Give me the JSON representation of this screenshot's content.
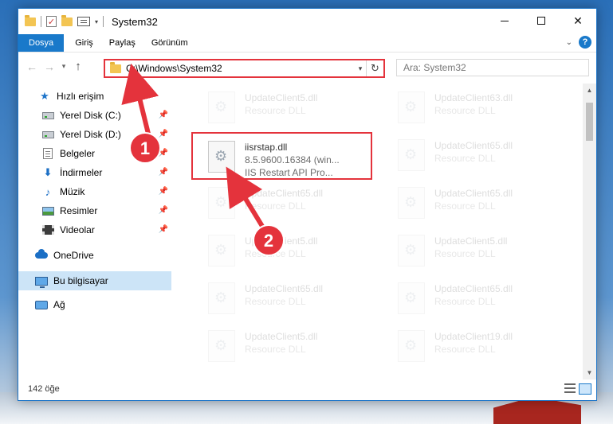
{
  "window": {
    "title": "System32",
    "controls": {
      "minimize": "–",
      "maximize": "□",
      "close": "✕"
    }
  },
  "ribbon": {
    "tabs": [
      "Dosya",
      "Giriş",
      "Paylaş",
      "Görünüm"
    ]
  },
  "address": {
    "path": "C:\\Windows\\System32",
    "search_placeholder": "Ara: System32"
  },
  "sidebar": {
    "items": [
      {
        "label": "Hızlı erişim",
        "icon": "star-icon"
      },
      {
        "label": "Yerel Disk (C:)",
        "icon": "drive-icon",
        "pinned": true
      },
      {
        "label": "Yerel Disk (D:)",
        "icon": "drive-icon",
        "pinned": true
      },
      {
        "label": "Belgeler",
        "icon": "documents-icon",
        "pinned": true
      },
      {
        "label": "İndirmeler",
        "icon": "download-icon",
        "pinned": true
      },
      {
        "label": "Müzik",
        "icon": "music-icon",
        "pinned": true
      },
      {
        "label": "Resimler",
        "icon": "pictures-icon",
        "pinned": true
      },
      {
        "label": "Videolar",
        "icon": "videos-icon",
        "pinned": true
      },
      {
        "label": "OneDrive",
        "icon": "cloud-icon"
      },
      {
        "label": "Bu bilgisayar",
        "icon": "computer-icon",
        "selected": true
      },
      {
        "label": "Ağ",
        "icon": "network-icon"
      }
    ]
  },
  "files": {
    "highlighted": {
      "name": "iisrstap.dll",
      "version": "8.5.9600.16384 (win...",
      "description": "IIS Restart API Pro..."
    },
    "faded": [
      {
        "name": "UpdateClient5.dll",
        "type": "Resource DLL"
      },
      {
        "name": "UpdateClient63.dll",
        "type": "Resource DLL"
      },
      {
        "name": "UpdateClient65.dll",
        "type": "Resource DLL"
      },
      {
        "name": "UpdateClient65.dll",
        "type": "Resource DLL"
      },
      {
        "name": "UpdateClient65.dll",
        "type": "Resource DLL"
      },
      {
        "name": "UpdateClient5.dll",
        "type": "Resource DLL"
      },
      {
        "name": "UpdateClient5.dll",
        "type": "Resource DLL"
      },
      {
        "name": "UpdateClient65.dll",
        "type": "Resource DLL"
      },
      {
        "name": "UpdateClient65.dll",
        "type": "Resource DLL"
      },
      {
        "name": "UpdateClient5.dll",
        "type": "Resource DLL"
      },
      {
        "name": "UpdateClient19.dll",
        "type": "Resource DLL"
      }
    ]
  },
  "status": {
    "count": "142 öğe"
  },
  "annotations": {
    "step1": "1",
    "step2": "2",
    "color": "#e4333c"
  }
}
